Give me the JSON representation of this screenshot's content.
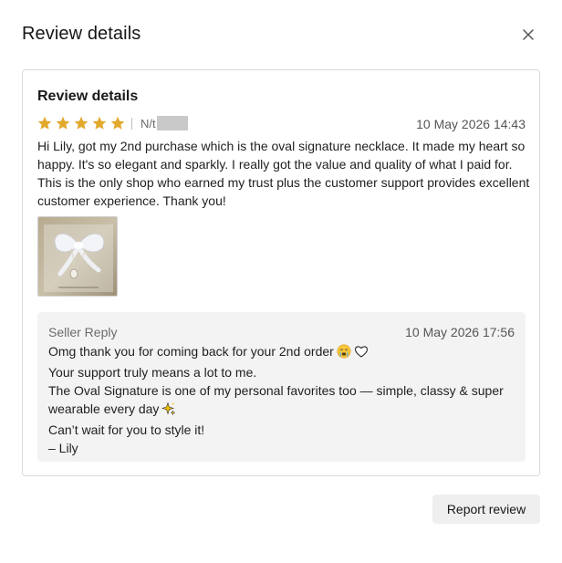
{
  "modal": {
    "title": "Review details",
    "close_icon": "close-icon"
  },
  "review": {
    "section_title": "Review details",
    "rating": 5,
    "max_rating": 5,
    "star_color": "#e2a92d",
    "reviewer": "N/t",
    "date": "10 May 2026 14:43",
    "text": "Hi Lily, got my 2nd purchase which is the oval signature necklace. It made my heart so happy. It's so elegant and sparkly. I really got the value and quality of what I paid for. This is the only shop who earned my trust plus the customer support provides excellent customer experience. Thank you!",
    "photo_icon": "review-photo"
  },
  "seller_reply": {
    "label": "Seller Reply",
    "date": "10 May 2026 17:56",
    "line1": "Omg thank you for coming back for your 2nd order",
    "line2": "Your support truly means a lot to me.",
    "line3": "The Oval Signature is one of my personal favorites too — simple, classy & super wearable every day",
    "line4": "Can’t wait for you to style it!",
    "line5": "– Lily",
    "emoji_1": "crying-face-icon",
    "emoji_2": "white-heart-icon",
    "emoji_3": "sparkles-icon"
  },
  "actions": {
    "report_label": "Report review"
  }
}
